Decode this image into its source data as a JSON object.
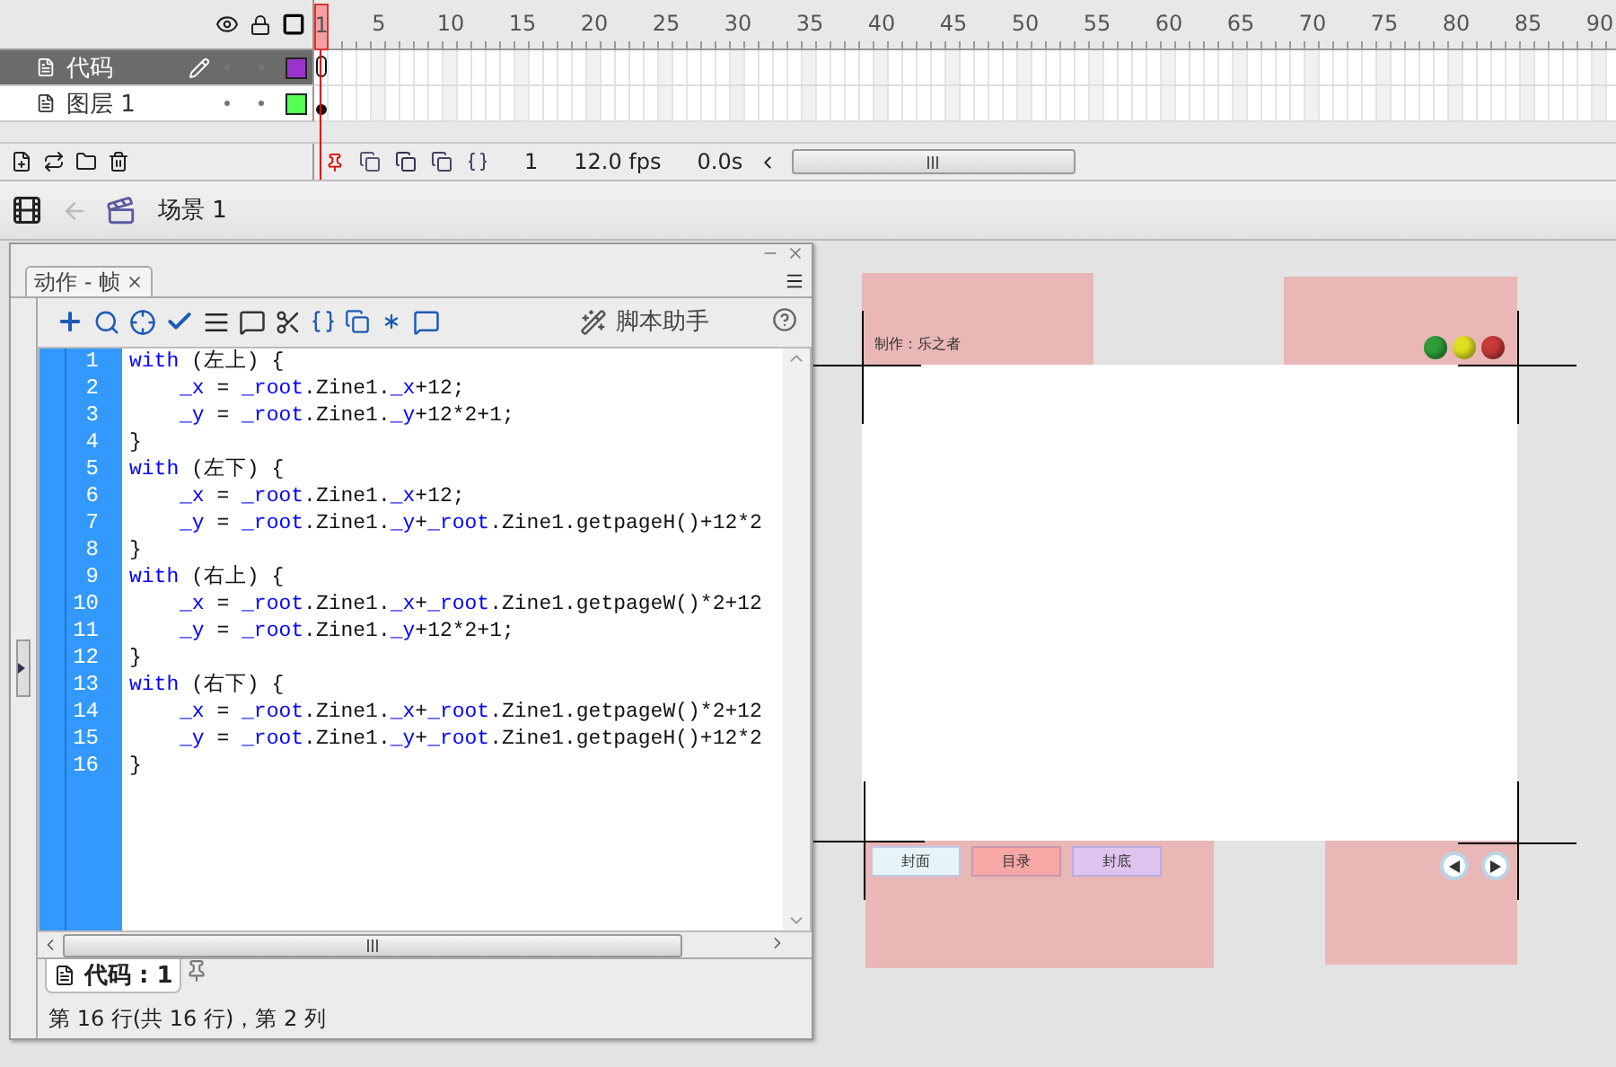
{
  "timeline": {
    "ruler": [
      "1",
      "5",
      "10",
      "15",
      "20",
      "25",
      "30",
      "35",
      "40",
      "45",
      "50",
      "55",
      "60",
      "65",
      "70",
      "75",
      "80",
      "85",
      "90"
    ],
    "layers": [
      {
        "name": "代码",
        "selected": true,
        "color": "#9933cc",
        "kind": "script"
      },
      {
        "name": "图层 1",
        "selected": false,
        "color": "#55ff55",
        "kind": "filled"
      }
    ],
    "status": {
      "frame": "1",
      "rate": "12.0 fps",
      "time": "0.0s"
    }
  },
  "edit_bar": {
    "scene": "场景 1"
  },
  "actions_panel": {
    "tab": "动作 - 帧",
    "assistant": "脚本助手",
    "lines": [
      {
        "number": "1",
        "kind": "block",
        "tokens": [
          {
            "kind": "keyword",
            "text": "with"
          },
          {
            "kind": "plain",
            "text": " (左上) {"
          }
        ]
      },
      {
        "number": "2",
        "kind": "statement",
        "tokens": [
          {
            "kind": "keyword",
            "text": "_x"
          },
          {
            "kind": "plain",
            "text": " = "
          },
          {
            "kind": "keyword",
            "text": "_root"
          },
          {
            "kind": "plain",
            "text": ".Zine1."
          },
          {
            "kind": "keyword",
            "text": "_x"
          },
          {
            "kind": "plain",
            "text": "+12;"
          }
        ]
      },
      {
        "number": "3",
        "kind": "statement",
        "tokens": [
          {
            "kind": "keyword",
            "text": "_y"
          },
          {
            "kind": "plain",
            "text": " = "
          },
          {
            "kind": "keyword",
            "text": "_root"
          },
          {
            "kind": "plain",
            "text": ".Zine1."
          },
          {
            "kind": "keyword",
            "text": "_y"
          },
          {
            "kind": "plain",
            "text": "+12*2+1;"
          }
        ]
      },
      {
        "number": "4",
        "kind": "block",
        "tokens": [
          {
            "kind": "plain",
            "text": "}"
          }
        ]
      },
      {
        "number": "5",
        "kind": "block",
        "tokens": [
          {
            "kind": "keyword",
            "text": "with"
          },
          {
            "kind": "plain",
            "text": " (左下) {"
          }
        ]
      },
      {
        "number": "6",
        "kind": "statement",
        "tokens": [
          {
            "kind": "keyword",
            "text": "_x"
          },
          {
            "kind": "plain",
            "text": " = "
          },
          {
            "kind": "keyword",
            "text": "_root"
          },
          {
            "kind": "plain",
            "text": ".Zine1."
          },
          {
            "kind": "keyword",
            "text": "_x"
          },
          {
            "kind": "plain",
            "text": "+12;"
          }
        ]
      },
      {
        "number": "7",
        "kind": "statement",
        "tokens": [
          {
            "kind": "keyword",
            "text": "_y"
          },
          {
            "kind": "plain",
            "text": " = "
          },
          {
            "kind": "keyword",
            "text": "_root"
          },
          {
            "kind": "plain",
            "text": ".Zine1."
          },
          {
            "kind": "keyword",
            "text": "_y"
          },
          {
            "kind": "plain",
            "text": "+"
          },
          {
            "kind": "keyword",
            "text": "_root"
          },
          {
            "kind": "plain",
            "text": ".Zine1.getpageH()+12*2"
          }
        ]
      },
      {
        "number": "8",
        "kind": "block",
        "tokens": [
          {
            "kind": "plain",
            "text": "}"
          }
        ]
      },
      {
        "number": "9",
        "kind": "block",
        "tokens": [
          {
            "kind": "keyword",
            "text": "with"
          },
          {
            "kind": "plain",
            "text": " (右上) {"
          }
        ]
      },
      {
        "number": "10",
        "kind": "statement",
        "tokens": [
          {
            "kind": "keyword",
            "text": "_x"
          },
          {
            "kind": "plain",
            "text": " = "
          },
          {
            "kind": "keyword",
            "text": "_root"
          },
          {
            "kind": "plain",
            "text": ".Zine1."
          },
          {
            "kind": "keyword",
            "text": "_x"
          },
          {
            "kind": "plain",
            "text": "+"
          },
          {
            "kind": "keyword",
            "text": "_root"
          },
          {
            "kind": "plain",
            "text": ".Zine1.getpageW()*2+12"
          }
        ]
      },
      {
        "number": "11",
        "kind": "statement",
        "tokens": [
          {
            "kind": "keyword",
            "text": "_y"
          },
          {
            "kind": "plain",
            "text": " = "
          },
          {
            "kind": "keyword",
            "text": "_root"
          },
          {
            "kind": "plain",
            "text": ".Zine1."
          },
          {
            "kind": "keyword",
            "text": "_y"
          },
          {
            "kind": "plain",
            "text": "+12*2+1;"
          }
        ]
      },
      {
        "number": "12",
        "kind": "block",
        "tokens": [
          {
            "kind": "plain",
            "text": "}"
          }
        ]
      },
      {
        "number": "13",
        "kind": "block",
        "tokens": [
          {
            "kind": "keyword",
            "text": "with"
          },
          {
            "kind": "plain",
            "text": " (右下) {"
          }
        ]
      },
      {
        "number": "14",
        "kind": "statement",
        "tokens": [
          {
            "kind": "keyword",
            "text": "_x"
          },
          {
            "kind": "plain",
            "text": " = "
          },
          {
            "kind": "keyword",
            "text": "_root"
          },
          {
            "kind": "plain",
            "text": ".Zine1."
          },
          {
            "kind": "keyword",
            "text": "_x"
          },
          {
            "kind": "plain",
            "text": "+"
          },
          {
            "kind": "keyword",
            "text": "_root"
          },
          {
            "kind": "plain",
            "text": ".Zine1.getpageW()*2+12"
          }
        ]
      },
      {
        "number": "15",
        "kind": "statement",
        "tokens": [
          {
            "kind": "keyword",
            "text": "_y"
          },
          {
            "kind": "plain",
            "text": " = "
          },
          {
            "kind": "keyword",
            "text": "_root"
          },
          {
            "kind": "plain",
            "text": ".Zine1."
          },
          {
            "kind": "keyword",
            "text": "_y"
          },
          {
            "kind": "plain",
            "text": "+"
          },
          {
            "kind": "keyword",
            "text": "_root"
          },
          {
            "kind": "plain",
            "text": ".Zine1.getpageH()+12*2"
          }
        ]
      },
      {
        "number": "16",
        "kind": "block",
        "tokens": [
          {
            "kind": "plain",
            "text": "}"
          }
        ]
      }
    ],
    "script_tab": "代码 : 1",
    "status": "第 16 行(共 16 行)，第 2 列"
  },
  "stage": {
    "credit": "制作：乐之者",
    "lights": [
      {
        "color": "#2e9e3a"
      },
      {
        "color": "#e0e020"
      },
      {
        "color": "#c83a3a"
      }
    ],
    "buttons": [
      {
        "label": "封面",
        "color": "#e6f4f8"
      },
      {
        "label": "目录",
        "color": "#f7a7a5"
      },
      {
        "label": "封底",
        "color": "#e0c4f0"
      }
    ]
  }
}
